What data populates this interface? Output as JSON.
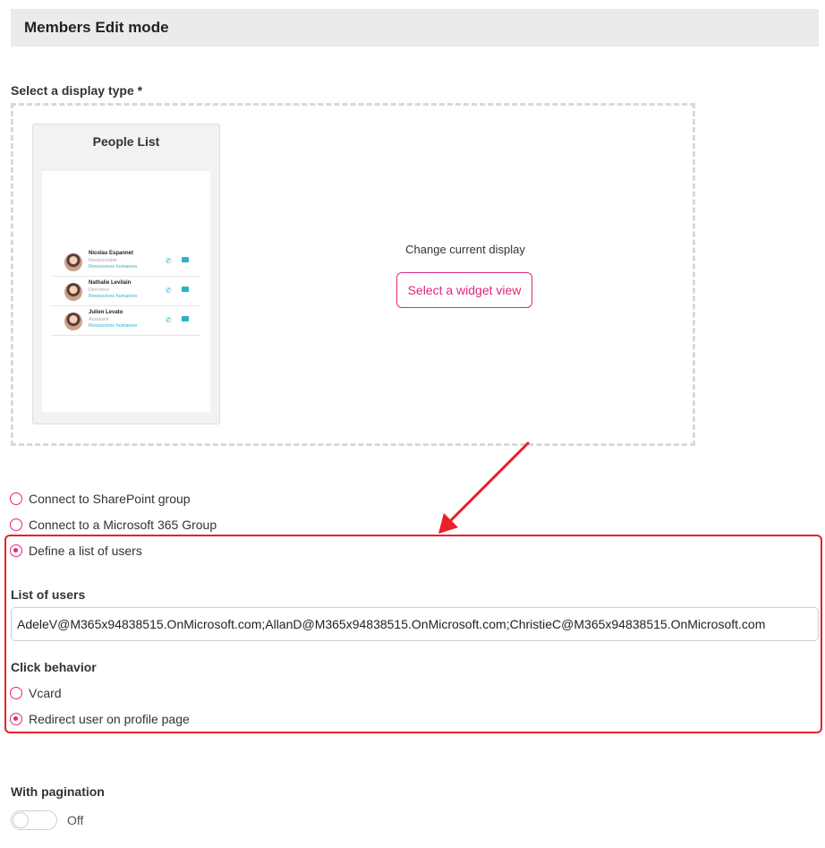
{
  "header": {
    "title": "Members Edit mode"
  },
  "display_type": {
    "label": "Select a display type *",
    "preview": {
      "title": "People List",
      "people": [
        {
          "name": "Nicolas Espannet",
          "role": "Responsable",
          "department": "Ressources humaines"
        },
        {
          "name": "Nathalie Levilain",
          "role": "Directrice",
          "department": "Ressources humaines"
        },
        {
          "name": "Julien Levato",
          "role": "Assistant",
          "department": "Ressources humaines"
        }
      ]
    },
    "change_text": "Change current display",
    "widget_button": "Select a widget view"
  },
  "source_options": [
    {
      "label": "Connect to SharePoint group",
      "checked": false
    },
    {
      "label": "Connect to a Microsoft 365 Group",
      "checked": false
    },
    {
      "label": "Define a list of users",
      "checked": true
    }
  ],
  "list_of_users": {
    "label": "List of users",
    "value": "AdeleV@M365x94838515.OnMicrosoft.com;AllanD@M365x94838515.OnMicrosoft.com;ChristieC@M365x94838515.OnMicrosoft.com"
  },
  "click_behavior": {
    "label": "Click behavior",
    "options": [
      {
        "label": "Vcard",
        "checked": false
      },
      {
        "label": "Redirect user on profile page",
        "checked": true
      }
    ]
  },
  "pagination": {
    "label": "With pagination",
    "state": "Off",
    "enabled": false
  },
  "colors": {
    "accent": "#e0287b",
    "annotation": "#e8212b",
    "link": "#2bb1c9"
  },
  "icons": {
    "phone": "phone-icon",
    "mail": "mail-icon"
  }
}
